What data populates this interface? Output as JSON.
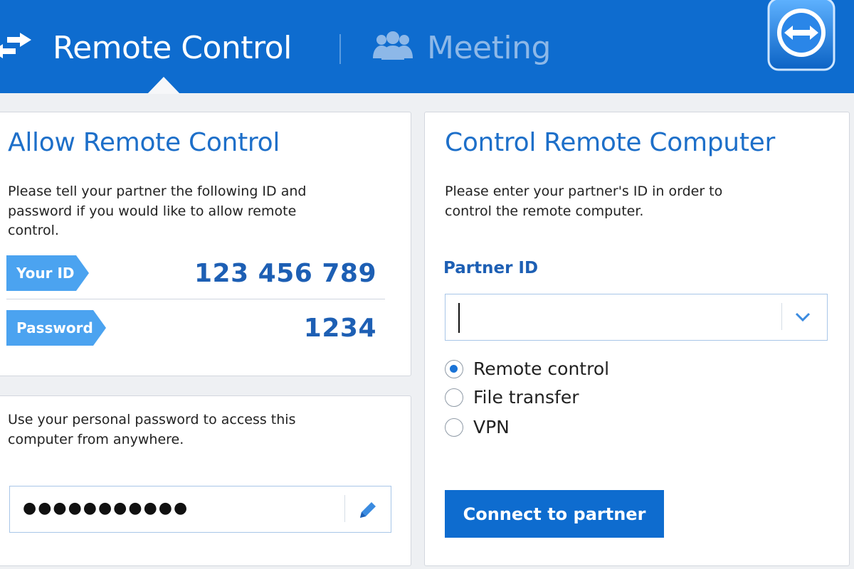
{
  "header": {
    "tabs": [
      {
        "label": "Remote Control",
        "icon": "arrows-icon",
        "active": true
      },
      {
        "label": "Meeting",
        "icon": "people-icon",
        "active": false
      }
    ],
    "logo": "teamviewer-logo"
  },
  "allow_panel": {
    "title": "Allow Remote Control",
    "description": "Please tell your partner the following ID and\npassword if you would like to allow remote\ncontrol.",
    "id_label": "Your ID",
    "id_value": "123 456 789",
    "password_label": "Password",
    "password_value": "1234"
  },
  "personal_panel": {
    "description": "Use your personal password to access this\ncomputer from anywhere.",
    "password_value": "●●●●●●●●●●●"
  },
  "control_panel": {
    "title": "Control Remote Computer",
    "description": "Please enter your partner's ID in order to\ncontrol the remote computer.",
    "partner_id_label": "Partner ID",
    "partner_id_value": "",
    "options": [
      {
        "label": "Remote control",
        "checked": true
      },
      {
        "label": "File transfer",
        "checked": false
      },
      {
        "label": "VPN",
        "checked": false
      }
    ],
    "connect_button": "Connect to partner"
  },
  "colors": {
    "accent": "#0e6ccf",
    "tag": "#4ba3f0",
    "title": "#1d6fc9"
  }
}
